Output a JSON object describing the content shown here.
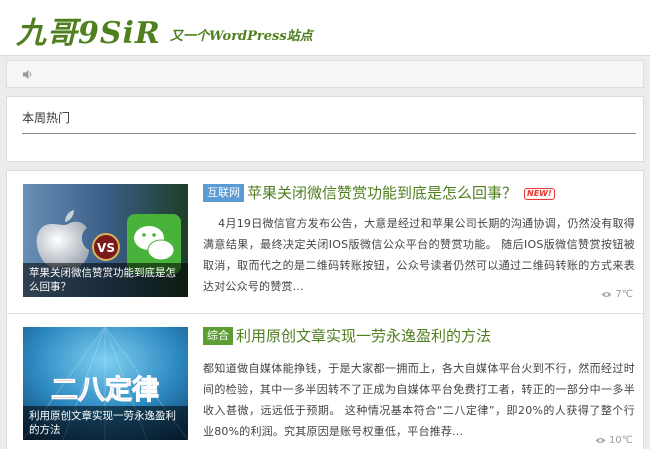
{
  "site": {
    "logo_text": "九哥9SiR",
    "tagline": "又一个WordPress站点",
    "brand_color": "#4f7f1e"
  },
  "notice": {
    "icon": "speaker-icon"
  },
  "hot_panel": {
    "title": "本周热门"
  },
  "articles": [
    {
      "category": "互联网",
      "category_color": "#5b9bd5",
      "title": "苹果关闭微信赞赏功能到底是怎么回事？",
      "new_badge": "NEW!",
      "thumb_caption": "苹果关闭微信赞赏功能到底是怎么回事？",
      "thumb_text": "VS",
      "excerpt": "4月19日微信官方发布公告，大意是经过和苹果公司长期的沟通协调，仍然没有取得满意结果，最终决定关闭IOS版微信公众平台的赞赏功能。 随后IOS版微信赞赏按钮被取消，取而代之的是二维码转账按钮，公众号读者仍然可以通过二维码转账的方式来表达对公众号的赞赏...",
      "views": "7℃"
    },
    {
      "category": "综合",
      "category_color": "#5c9e33",
      "title": "利用原创文章实现一劳永逸盈利的方法",
      "thumb_caption": "利用原创文章实现一劳永逸盈利的方法",
      "thumb_text": "二八定律",
      "excerpt": "都知道做自媒体能挣钱，于是大家都一拥而上，各大自媒体平台火到不行，然而经过时间的检验，其中一多半因转不了正成为自媒体平台免费打工者，转正的一部分中一多半收入甚微，远远低于预期。 这种情况基本符合“二八定律”，即20%的人获得了整个行业80%的利润。究其原因是账号权重低，平台推荐...",
      "views": "10℃"
    }
  ]
}
